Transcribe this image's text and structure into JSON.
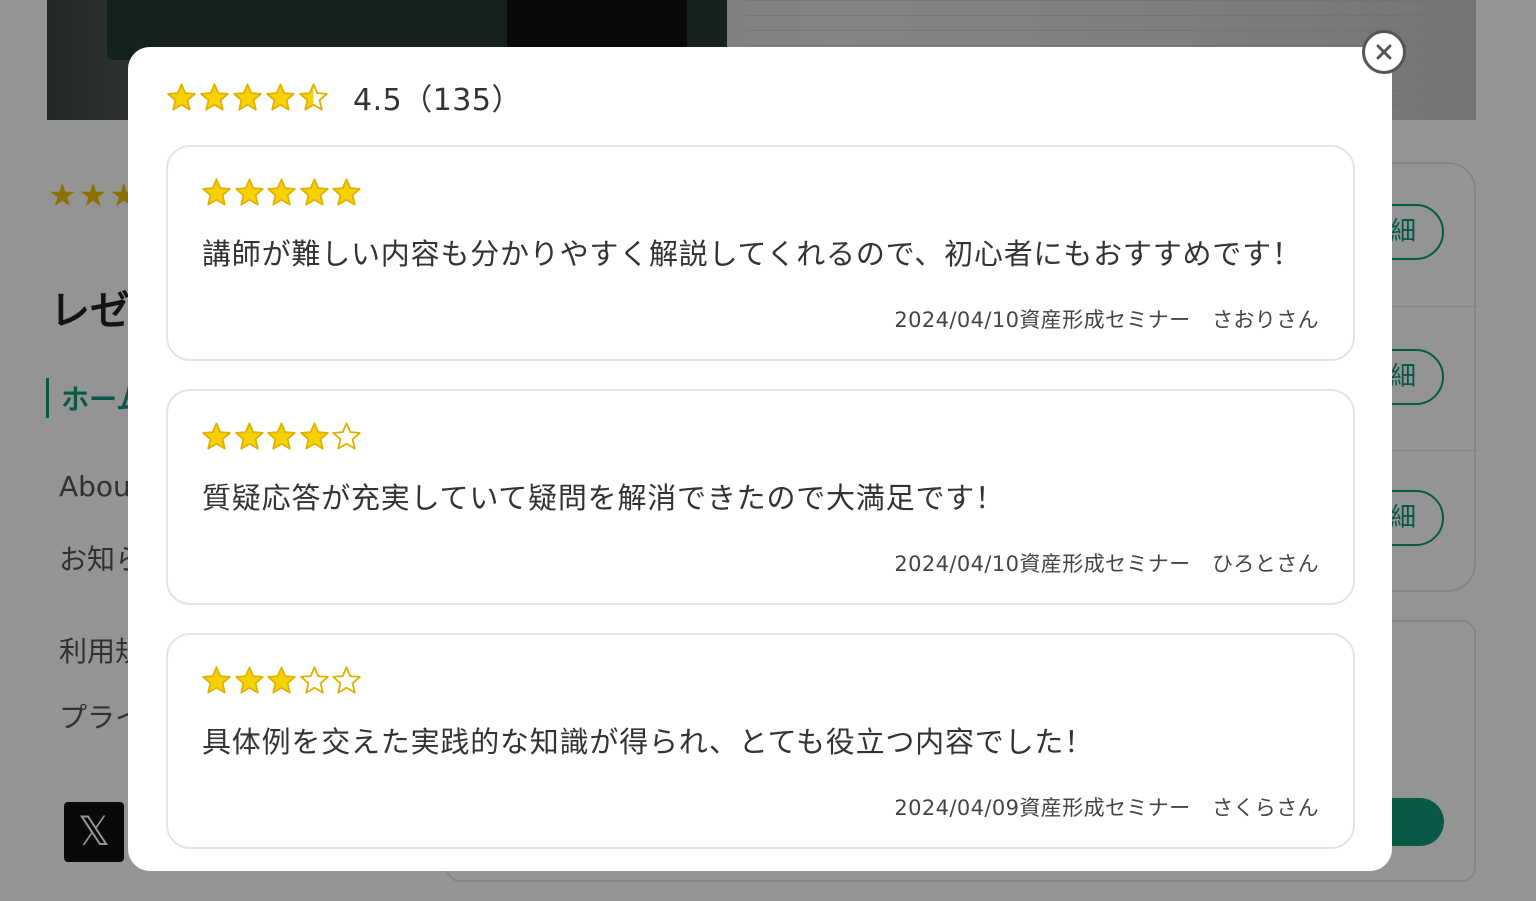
{
  "background": {
    "title_partial": "レゼ",
    "home_label": "ホーム",
    "links": [
      "Abou",
      "お知ら",
      "利用規",
      "プライ"
    ],
    "detail_label": "細",
    "x_logo": "𝕏",
    "bg_rating": 3
  },
  "modal": {
    "overall_rating": 4.5,
    "summary_text": "4.5（135）",
    "close_icon": "close-circle-icon",
    "reviews": [
      {
        "rating": 5,
        "text": "講師が難しい内容も分かりやすく解説してくれるので、初心者にもおすすめです！",
        "meta": "2024/04/10資産形成セミナー　さおりさん"
      },
      {
        "rating": 4,
        "text": "質疑応答が充実していて疑問を解消できたので大満足です！",
        "meta": "2024/04/10資産形成セミナー　ひろとさん"
      },
      {
        "rating": 3,
        "text": "具体例を交えた実践的な知識が得られ、とても役立つ内容でした！",
        "meta": "2024/04/09資産形成セミナー　さくらさん"
      }
    ]
  },
  "colors": {
    "star_fill": "#f7d200",
    "star_stroke": "#e0b100",
    "accent": "#0e9b7a",
    "overlay": "rgba(0,0,0,0.42)"
  }
}
